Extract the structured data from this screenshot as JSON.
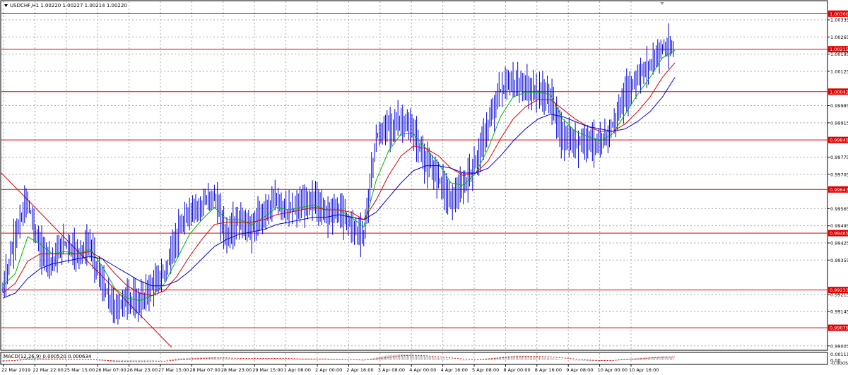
{
  "chart_data": {
    "type": "candlestick",
    "symbol_info": "USDCHF,H1  1.00220 1.00227 1.00214 1.00220",
    "grid": true,
    "y_ticks": [
      "1.00335",
      "1.00265",
      "1.00195",
      "1.00125",
      "0.99985",
      "0.99915",
      "0.99775",
      "0.99705",
      "0.99565",
      "0.99495",
      "0.99425",
      "0.99355",
      "0.99215",
      "0.99145",
      "0.99005"
    ],
    "x_ticks": [
      "22 Mar 2019",
      "22 Mar 22:00",
      "25 Mar 15:00",
      "26 Mar 07:00",
      "26 Mar 23:00",
      "27 Mar 15:00",
      "28 Mar 07:00",
      "28 Mar 23:00",
      "29 Mar 15:00",
      "1 Apr 08:00",
      "2 Apr 00:00",
      "2 Apr 16:00",
      "3 Apr 08:00",
      "4 Apr 00:00",
      "4 Apr 16:00",
      "5 Apr 08:00",
      "8 Apr 00:00",
      "8 Apr 16:00",
      "9 Apr 08:00",
      "10 Apr 00:00",
      "10 Apr 16:00"
    ],
    "price_range": [
      0.9899,
      1.0041
    ],
    "horizontal_levels": [
      {
        "label": "1.00360",
        "value": 1.0036
      },
      {
        "label": "1.00215",
        "value": 1.00215
      },
      {
        "label": "1.00042",
        "value": 1.00042
      },
      {
        "label": "0.99845",
        "value": 0.99845
      },
      {
        "label": "0.99643",
        "value": 0.99643
      },
      {
        "label": "0.99465",
        "value": 0.99465
      },
      {
        "label": "0.99233",
        "value": 0.99233
      },
      {
        "label": "0.99079",
        "value": 0.99079
      }
    ],
    "trendline": {
      "from": {
        "time": "22 Mar 2019",
        "price": 0.9971
      },
      "to": {
        "time": "26 Mar 23:00",
        "price": 0.99
      }
    },
    "series": [
      {
        "values": [
          0.9923,
          0.9945,
          0.996,
          0.994,
          0.9935,
          0.9943,
          0.9938,
          0.9942,
          0.9926,
          0.9915,
          0.992,
          0.9918,
          0.9925,
          0.993,
          0.9945,
          0.9955,
          0.9958,
          0.9962,
          0.9945,
          0.9952,
          0.9948,
          0.9955,
          0.996,
          0.9955,
          0.9958,
          0.996,
          0.9955,
          0.9956,
          0.995,
          0.9945,
          0.9985,
          0.999,
          0.9992,
          0.9988,
          0.9975,
          0.997,
          0.996,
          0.9965,
          0.9975,
          0.999,
          1.0005,
          1.0008,
          1.0006,
          1.0004,
          1.0002,
          0.9985,
          0.9983,
          0.9985,
          0.9982,
          0.999,
          1.0002,
          1.001,
          1.0015,
          1.0022,
          1.0021
        ]
      },
      {
        "color": "#00b400",
        "values": [
          0.9925,
          0.993,
          0.9945,
          0.9942,
          0.9938,
          0.9939,
          0.9938,
          0.994,
          0.9933,
          0.9924,
          0.992,
          0.9919,
          0.9921,
          0.9926,
          0.9936,
          0.9946,
          0.9952,
          0.9957,
          0.9952,
          0.9952,
          0.995,
          0.9953,
          0.9957,
          0.9956,
          0.9957,
          0.9958,
          0.9956,
          0.9956,
          0.9953,
          0.9949,
          0.9968,
          0.998,
          0.9987,
          0.9987,
          0.9981,
          0.9975,
          0.9967,
          0.9966,
          0.9971,
          0.9981,
          0.9994,
          1.0002,
          1.0004,
          1.0004,
          1.0003,
          0.9993,
          0.9988,
          0.9986,
          0.9984,
          0.9987,
          0.9995,
          1.0003,
          1.001,
          1.0018,
          1.0021
        ]
      },
      {
        "color": "#e00000",
        "values": [
          0.9922,
          0.9926,
          0.9935,
          0.9938,
          0.9938,
          0.9938,
          0.9938,
          0.9939,
          0.9936,
          0.993,
          0.9925,
          0.9922,
          0.9921,
          0.9923,
          0.9929,
          0.9937,
          0.9944,
          0.995,
          0.9951,
          0.9951,
          0.9951,
          0.9952,
          0.9954,
          0.9955,
          0.9956,
          0.9957,
          0.9956,
          0.9956,
          0.9955,
          0.9952,
          0.996,
          0.997,
          0.9978,
          0.9982,
          0.9981,
          0.9978,
          0.9973,
          0.997,
          0.9971,
          0.9976,
          0.9985,
          0.9993,
          0.9998,
          1.0001,
          1.0001,
          0.9997,
          0.9993,
          0.999,
          0.9988,
          0.9988,
          0.9991,
          0.9996,
          1.0002,
          1.001,
          1.0016
        ]
      },
      {
        "color": "#0000dc",
        "values": [
          0.992,
          0.9922,
          0.9928,
          0.9932,
          0.9934,
          0.9935,
          0.9936,
          0.9937,
          0.9936,
          0.9933,
          0.993,
          0.9927,
          0.9925,
          0.9925,
          0.9927,
          0.9931,
          0.9936,
          0.9941,
          0.9944,
          0.9946,
          0.9947,
          0.9948,
          0.995,
          0.9951,
          0.9952,
          0.9953,
          0.9953,
          0.9954,
          0.9953,
          0.9952,
          0.9955,
          0.9961,
          0.9967,
          0.9972,
          0.9974,
          0.9974,
          0.9973,
          0.9971,
          0.9971,
          0.9973,
          0.9978,
          0.9984,
          0.9989,
          0.9993,
          0.9995,
          0.9994,
          0.9992,
          0.999,
          0.9989,
          0.9988,
          0.9989,
          0.9992,
          0.9996,
          1.0002,
          1.001
        ]
      }
    ],
    "macd": {
      "label": "MACD(12,26,9) 0.000520 0.000634",
      "y_ticks": [
        "0.001114",
        "0.00",
        "-0.00059"
      ],
      "y_range": [
        -0.0007,
        0.0013
      ],
      "histogram": [
        -0.0003,
        0.0001,
        0.0004,
        0.0003,
        0.0002,
        0.0001,
        0.0,
        0.0001,
        -0.0002,
        -0.0004,
        -0.0004,
        -0.0003,
        -0.0002,
        0.0,
        0.0003,
        0.0004,
        0.0005,
        0.0005,
        0.0003,
        0.0002,
        0.0002,
        0.0003,
        0.0003,
        0.0002,
        0.0002,
        0.0002,
        0.0001,
        0.0001,
        0.0,
        -0.0001,
        0.0005,
        0.0009,
        0.0011,
        0.001,
        0.0007,
        0.0004,
        0.0001,
        -0.0001,
        0.0,
        0.0003,
        0.0006,
        0.0008,
        0.0008,
        0.0006,
        0.0004,
        0.0001,
        -0.0001,
        -0.0002,
        -0.0002,
        0.0,
        0.0002,
        0.0004,
        0.0005,
        0.0007,
        0.0006
      ],
      "signal": [
        -0.0002,
        -0.0001,
        0.0001,
        0.0002,
        0.0002,
        0.0002,
        0.0001,
        0.0001,
        0.0,
        -0.0002,
        -0.0003,
        -0.0003,
        -0.0003,
        -0.0002,
        0.0,
        0.0002,
        0.0003,
        0.0004,
        0.0004,
        0.0003,
        0.0003,
        0.0003,
        0.0003,
        0.0003,
        0.0002,
        0.0002,
        0.0002,
        0.0001,
        0.0001,
        0.0,
        0.0002,
        0.0005,
        0.0008,
        0.0009,
        0.0008,
        0.0006,
        0.0004,
        0.0002,
        0.0001,
        0.0002,
        0.0004,
        0.0006,
        0.0007,
        0.0007,
        0.0006,
        0.0004,
        0.0002,
        0.0,
        -0.0001,
        -0.0001,
        0.0001,
        0.0002,
        0.0004,
        0.0005,
        0.0006
      ]
    },
    "colors": {
      "bars": "#0000dc",
      "level_lines": "#e00000",
      "label_bg": "#e00000",
      "grid": "#a9a9a9",
      "histogram": "#a9a9a9",
      "macd_signal": "#e00000"
    }
  }
}
